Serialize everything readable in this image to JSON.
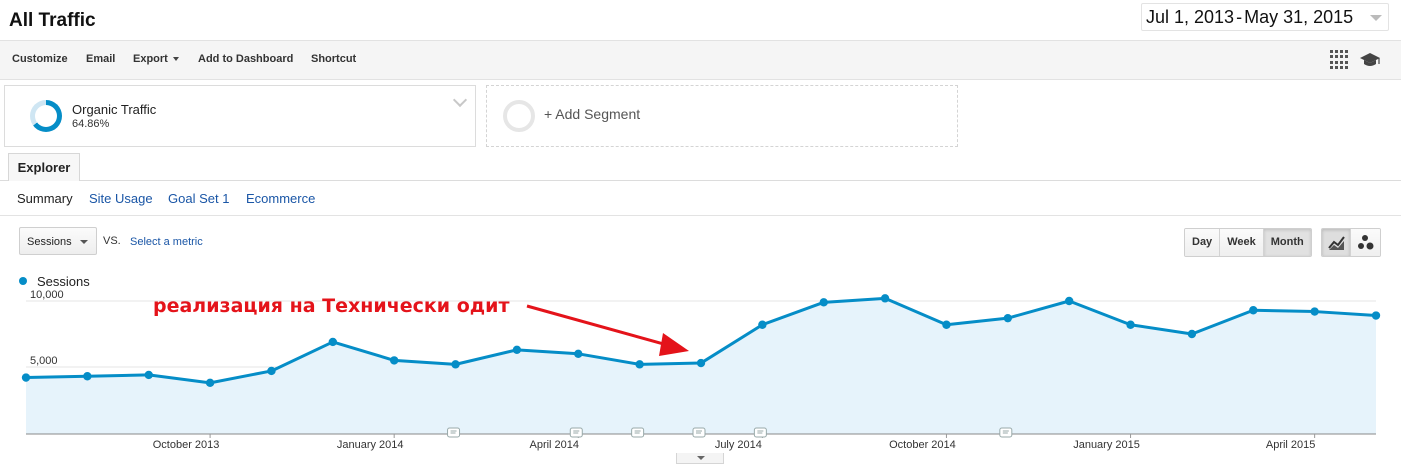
{
  "header": {
    "title": "All Traffic",
    "date_start": "Jul 1, 2013",
    "date_sep": "-",
    "date_end": "May 31, 2015"
  },
  "toolbar": {
    "customize": "Customize",
    "email": "Email",
    "export": "Export",
    "add_to_dashboard": "Add to Dashboard",
    "shortcut": "Shortcut",
    "icons": [
      "grid-icon",
      "graduation-cap-icon"
    ]
  },
  "segments": {
    "active": {
      "name": "Organic Traffic",
      "percent": "64.86%",
      "share": 0.6486
    },
    "add_label": "+ Add Segment"
  },
  "tabs": {
    "explorer": "Explorer"
  },
  "subnav": {
    "summary": "Summary",
    "site_usage": "Site Usage",
    "goal_set": "Goal Set 1",
    "ecommerce": "Ecommerce"
  },
  "controls": {
    "metric": "Sessions",
    "vs": "VS.",
    "select_metric": "Select a metric",
    "day": "Day",
    "week": "Week",
    "month": "Month",
    "selected_range": "Month",
    "chart_type_icons": [
      "line-chart-icon",
      "motion-chart-icon"
    ]
  },
  "legend": {
    "series": "Sessions",
    "color": "#058dc7"
  },
  "annotation_text": "реализация на Технически одит",
  "annotation_color": "#e4131a",
  "chart_data": {
    "type": "area",
    "x": [
      "Jul 2013",
      "Aug 2013",
      "Sep 2013",
      "Oct 2013",
      "Nov 2013",
      "Dec 2013",
      "Jan 2014",
      "Feb 2014",
      "Mar 2014",
      "Apr 2014",
      "May 2014",
      "Jun 2014",
      "Jul 2014",
      "Aug 2014",
      "Sep 2014",
      "Oct 2014",
      "Nov 2014",
      "Dec 2014",
      "Jan 2015",
      "Feb 2015",
      "Mar 2015",
      "Apr 2015",
      "May 2015"
    ],
    "series": [
      {
        "name": "Sessions",
        "values": [
          4200,
          4300,
          4400,
          3800,
          4700,
          6900,
          5500,
          5200,
          6300,
          6000,
          5200,
          5300,
          8200,
          9900,
          10200,
          8200,
          8700,
          10000,
          8200,
          7500,
          9300,
          9200,
          8900
        ]
      }
    ],
    "y_ticks": [
      "10,000",
      "5,000"
    ],
    "y_tick_values": [
      10000,
      5000
    ],
    "x_tick_labels": [
      "October 2013",
      "January 2014",
      "April 2014",
      "July 2014",
      "October 2014",
      "January 2015",
      "April 2015"
    ],
    "x_tick_indices": [
      3,
      6,
      9,
      12,
      15,
      18,
      21
    ],
    "note_marker_months": [
      "Feb 2014",
      "Apr 2014",
      "May 2014",
      "Jun 2014",
      "Jul 2014",
      "Nov 2014"
    ],
    "ylim": [
      0,
      11000
    ],
    "grid": true,
    "line_color": "#058dc7",
    "fill_color": "#e6f3fb"
  }
}
